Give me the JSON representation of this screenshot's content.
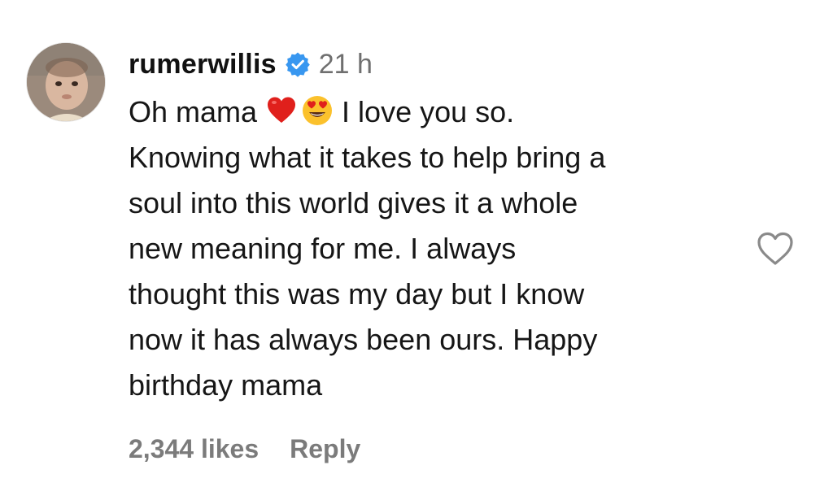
{
  "comment": {
    "username": "rumerwillis",
    "verified": true,
    "timestamp": "21 h",
    "text_before_emoji": "Oh mama ",
    "emoji_1": "red-heart",
    "emoji_2": "smiling-face-with-heart-eyes",
    "text_after_emoji": " I love you so.",
    "body_lines": [
      "Knowing what it takes to help bring a",
      "soul into this world gives it a whole",
      "new meaning for me. I always",
      "thought this was my day but I know",
      "now it has always been ours. Happy",
      "birthday mama"
    ],
    "likes": "2,344 likes",
    "reply_label": "Reply",
    "like_icon": "heart-outline-icon"
  },
  "colors": {
    "verified_blue": "#3897f0",
    "meta_gray": "#7b7b7b",
    "text": "#161616"
  }
}
